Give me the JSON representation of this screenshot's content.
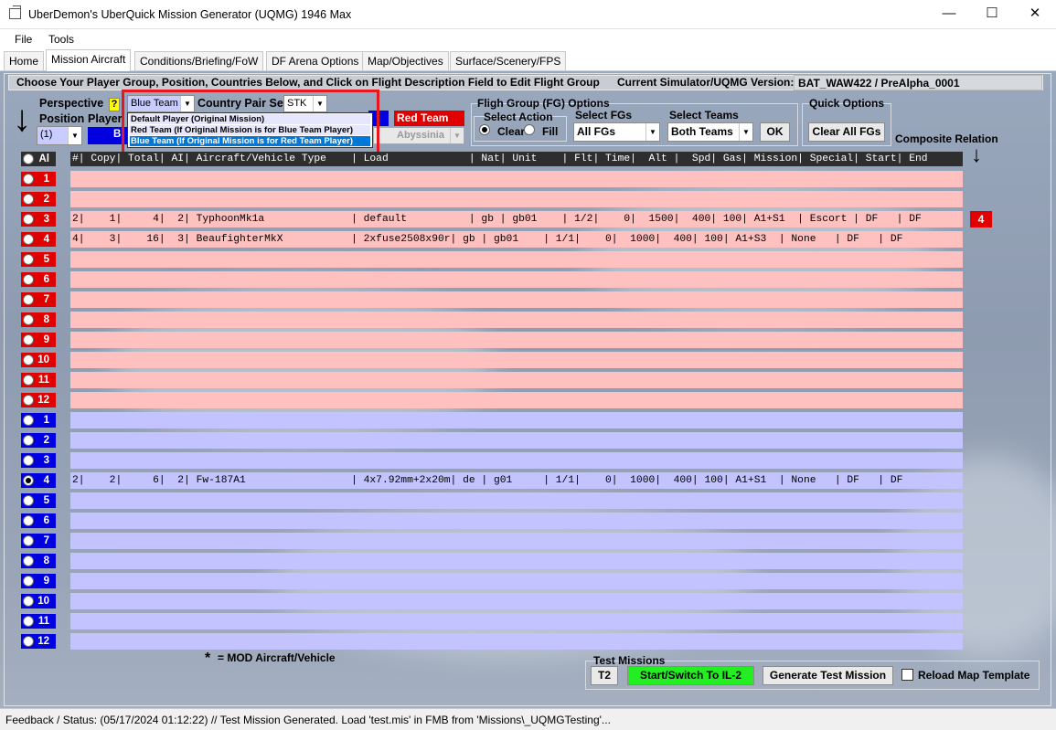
{
  "window": {
    "title": "UberDemon's UberQuick Mission Generator (UQMG) 1946 Max",
    "minimize": "—",
    "maximize": "☐",
    "close": "✕"
  },
  "menu": [
    "File",
    "Tools"
  ],
  "tabs": [
    "Home",
    "Mission Aircraft",
    "Conditions/Briefing/FoW",
    "DF Arena Options",
    "Map/Objectives",
    "Surface/Scenery/FPS"
  ],
  "instructions": "Choose Your Player Group, Position, Countries Below, and Click on Flight Description Field to Edit Flight Group",
  "version": {
    "label": "Current Simulator/UQMG Version:",
    "value": "BAT_WAW422 / PreAlpha_0001"
  },
  "perspective": {
    "label": "Perspective",
    "help": "?",
    "selected": "Blue Team (",
    "options": [
      "Default Player (Original Mission)",
      "Red Team (If Original Mission is for Blue Team Player)",
      "Blue Team (If Original Mission is for Red Team Player)"
    ]
  },
  "country_pair": {
    "label": "Country Pair Set",
    "value": "STK"
  },
  "position": {
    "label": "Position",
    "value": "(1)"
  },
  "player": {
    "label": "Player",
    "value": "Bl"
  },
  "red_team": {
    "label": "Red Team",
    "value": "Abyssinia"
  },
  "fg_options": {
    "title": "Fligh Group (FG) Options",
    "select_action": "Select Action",
    "clear": "Clear",
    "fill": "Fill",
    "select_fgs_label": "Select FGs",
    "select_fgs_value": "All FGs",
    "select_teams_label": "Select Teams",
    "select_teams_value": "Both Teams",
    "ok": "OK"
  },
  "quick_options": {
    "title": "Quick Options",
    "clear_all": "Clear All FGs"
  },
  "composite": {
    "label": "Composite Relation",
    "badge": "4"
  },
  "all_label": "Al",
  "table_header": "#| Copy| Total| AI| Aircraft/Vehicle Type    | Load             | Nat| Unit    | Flt| Time|  Alt |  Spd| Gas| Mission| Special| Start| End",
  "red_rows": [
    {
      "num": "1",
      "text": ""
    },
    {
      "num": "2",
      "text": ""
    },
    {
      "num": "3",
      "text": "2|    1|     4|  2| TyphoonMk1a              | default          | gb | gb01    | 1/2|    0|  1500|  400| 100| A1+S1  | Escort | DF   | DF"
    },
    {
      "num": "4",
      "text": "4|    3|    16|  3| BeaufighterMkX           | 2xfuse2508x90r| gb | gb01    | 1/1|    0|  1000|  400| 100| A1+S3  | None   | DF   | DF"
    },
    {
      "num": "5",
      "text": ""
    },
    {
      "num": "6",
      "text": ""
    },
    {
      "num": "7",
      "text": ""
    },
    {
      "num": "8",
      "text": ""
    },
    {
      "num": "9",
      "text": ""
    },
    {
      "num": "10",
      "text": ""
    },
    {
      "num": "11",
      "text": ""
    },
    {
      "num": "12",
      "text": ""
    }
  ],
  "blue_rows": [
    {
      "num": "1",
      "text": ""
    },
    {
      "num": "2",
      "text": ""
    },
    {
      "num": "3",
      "text": ""
    },
    {
      "num": "4",
      "text": "2|    2|     6|  2| Fw-187A1                 | 4x7.92mm+2x20m| de | g01     | 1/1|    0|  1000|  400| 100| A1+S1  | None   | DF   | DF"
    },
    {
      "num": "5",
      "text": ""
    },
    {
      "num": "6",
      "text": ""
    },
    {
      "num": "7",
      "text": ""
    },
    {
      "num": "8",
      "text": ""
    },
    {
      "num": "9",
      "text": ""
    },
    {
      "num": "10",
      "text": ""
    },
    {
      "num": "11",
      "text": ""
    },
    {
      "num": "12",
      "text": ""
    }
  ],
  "mod_note": {
    "star": "*",
    "text": "= MOD Aircraft/Vehicle"
  },
  "test_missions": {
    "title": "Test Missions",
    "t2": "T2",
    "start": "Start/Switch To IL-2",
    "generate": "Generate Test Mission",
    "reload": "Reload Map Template"
  },
  "status": "Feedback / Status:  (05/17/2024 01:12:22) // Test Mission Generated.  Load 'test.mis' in FMB from 'Missions\\_UQMGTesting'...",
  "colors": {
    "red": "#e00000",
    "blue": "#0000e0",
    "red_row": "#ffc0c0",
    "blue_row": "#c3c3ff",
    "highlight": "#e8161f",
    "green": "#22ee22"
  }
}
